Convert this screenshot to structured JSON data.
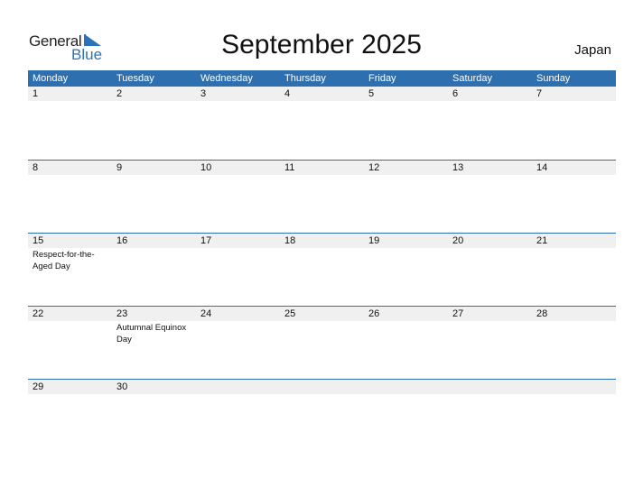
{
  "logo": {
    "word1": "General",
    "word2": "Blue"
  },
  "title": "September 2025",
  "country": "Japan",
  "colors": {
    "accent": "#2e6fb0",
    "date_band": "#f0f0f0",
    "logo_blue": "#2a73b8"
  },
  "weekdays": [
    "Monday",
    "Tuesday",
    "Wednesday",
    "Thursday",
    "Friday",
    "Saturday",
    "Sunday"
  ],
  "weeks": [
    {
      "days": [
        {
          "d": "1",
          "ev": ""
        },
        {
          "d": "2",
          "ev": ""
        },
        {
          "d": "3",
          "ev": ""
        },
        {
          "d": "4",
          "ev": ""
        },
        {
          "d": "5",
          "ev": ""
        },
        {
          "d": "6",
          "ev": ""
        },
        {
          "d": "7",
          "ev": ""
        }
      ]
    },
    {
      "days": [
        {
          "d": "8",
          "ev": ""
        },
        {
          "d": "9",
          "ev": ""
        },
        {
          "d": "10",
          "ev": ""
        },
        {
          "d": "11",
          "ev": ""
        },
        {
          "d": "12",
          "ev": ""
        },
        {
          "d": "13",
          "ev": ""
        },
        {
          "d": "14",
          "ev": ""
        }
      ]
    },
    {
      "days": [
        {
          "d": "15",
          "ev": "Respect-for-the-Aged Day"
        },
        {
          "d": "16",
          "ev": ""
        },
        {
          "d": "17",
          "ev": ""
        },
        {
          "d": "18",
          "ev": ""
        },
        {
          "d": "19",
          "ev": ""
        },
        {
          "d": "20",
          "ev": ""
        },
        {
          "d": "21",
          "ev": ""
        }
      ]
    },
    {
      "days": [
        {
          "d": "22",
          "ev": ""
        },
        {
          "d": "23",
          "ev": "Autumnal Equinox Day"
        },
        {
          "d": "24",
          "ev": ""
        },
        {
          "d": "25",
          "ev": ""
        },
        {
          "d": "26",
          "ev": ""
        },
        {
          "d": "27",
          "ev": ""
        },
        {
          "d": "28",
          "ev": ""
        }
      ]
    },
    {
      "days": [
        {
          "d": "29",
          "ev": ""
        },
        {
          "d": "30",
          "ev": ""
        },
        {
          "d": "",
          "ev": ""
        },
        {
          "d": "",
          "ev": ""
        },
        {
          "d": "",
          "ev": ""
        },
        {
          "d": "",
          "ev": ""
        },
        {
          "d": "",
          "ev": ""
        }
      ]
    }
  ]
}
